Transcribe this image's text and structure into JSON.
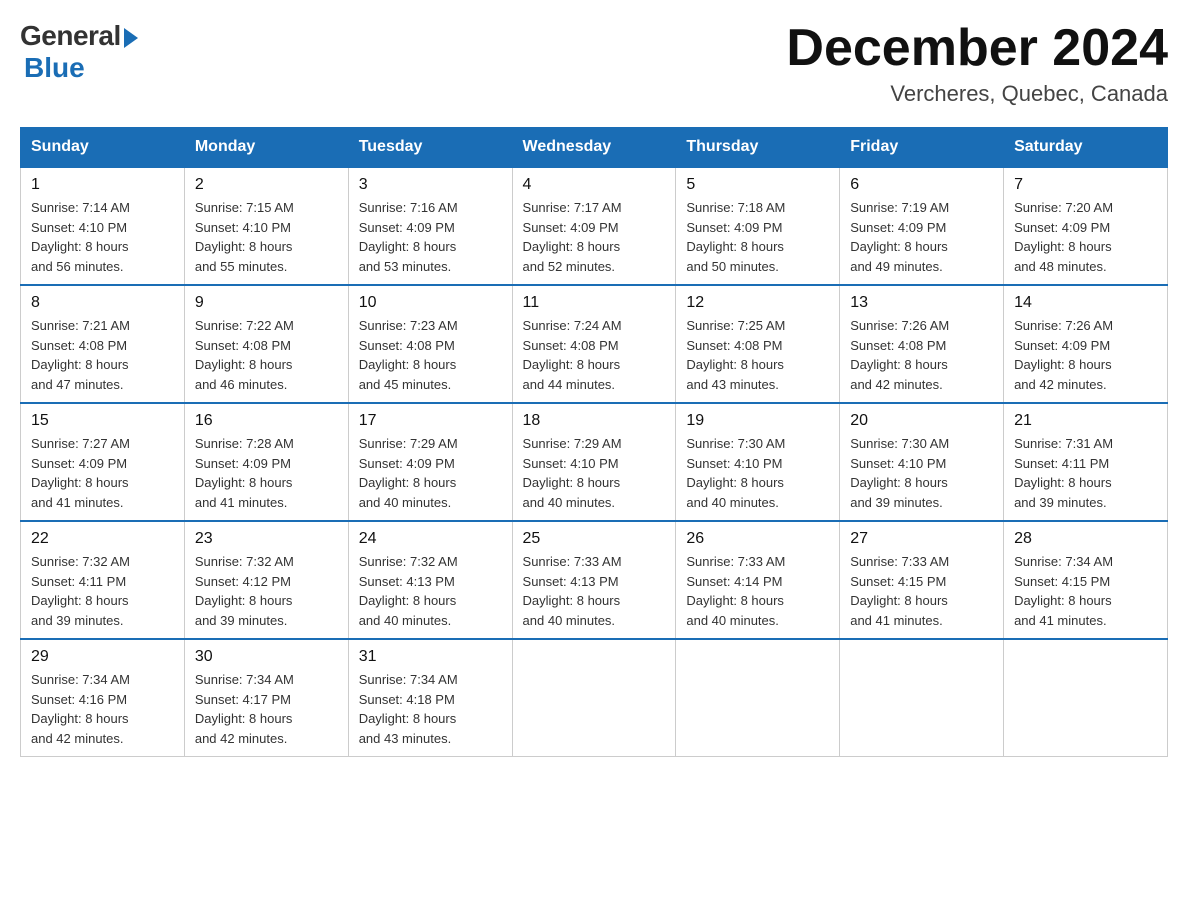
{
  "header": {
    "logo_general": "General",
    "logo_blue": "Blue",
    "month_title": "December 2024",
    "location": "Vercheres, Quebec, Canada"
  },
  "days_of_week": [
    "Sunday",
    "Monday",
    "Tuesday",
    "Wednesday",
    "Thursday",
    "Friday",
    "Saturday"
  ],
  "weeks": [
    [
      {
        "day": "1",
        "sunrise": "7:14 AM",
        "sunset": "4:10 PM",
        "daylight": "8 hours and 56 minutes."
      },
      {
        "day": "2",
        "sunrise": "7:15 AM",
        "sunset": "4:10 PM",
        "daylight": "8 hours and 55 minutes."
      },
      {
        "day": "3",
        "sunrise": "7:16 AM",
        "sunset": "4:09 PM",
        "daylight": "8 hours and 53 minutes."
      },
      {
        "day": "4",
        "sunrise": "7:17 AM",
        "sunset": "4:09 PM",
        "daylight": "8 hours and 52 minutes."
      },
      {
        "day": "5",
        "sunrise": "7:18 AM",
        "sunset": "4:09 PM",
        "daylight": "8 hours and 50 minutes."
      },
      {
        "day": "6",
        "sunrise": "7:19 AM",
        "sunset": "4:09 PM",
        "daylight": "8 hours and 49 minutes."
      },
      {
        "day": "7",
        "sunrise": "7:20 AM",
        "sunset": "4:09 PM",
        "daylight": "8 hours and 48 minutes."
      }
    ],
    [
      {
        "day": "8",
        "sunrise": "7:21 AM",
        "sunset": "4:08 PM",
        "daylight": "8 hours and 47 minutes."
      },
      {
        "day": "9",
        "sunrise": "7:22 AM",
        "sunset": "4:08 PM",
        "daylight": "8 hours and 46 minutes."
      },
      {
        "day": "10",
        "sunrise": "7:23 AM",
        "sunset": "4:08 PM",
        "daylight": "8 hours and 45 minutes."
      },
      {
        "day": "11",
        "sunrise": "7:24 AM",
        "sunset": "4:08 PM",
        "daylight": "8 hours and 44 minutes."
      },
      {
        "day": "12",
        "sunrise": "7:25 AM",
        "sunset": "4:08 PM",
        "daylight": "8 hours and 43 minutes."
      },
      {
        "day": "13",
        "sunrise": "7:26 AM",
        "sunset": "4:08 PM",
        "daylight": "8 hours and 42 minutes."
      },
      {
        "day": "14",
        "sunrise": "7:26 AM",
        "sunset": "4:09 PM",
        "daylight": "8 hours and 42 minutes."
      }
    ],
    [
      {
        "day": "15",
        "sunrise": "7:27 AM",
        "sunset": "4:09 PM",
        "daylight": "8 hours and 41 minutes."
      },
      {
        "day": "16",
        "sunrise": "7:28 AM",
        "sunset": "4:09 PM",
        "daylight": "8 hours and 41 minutes."
      },
      {
        "day": "17",
        "sunrise": "7:29 AM",
        "sunset": "4:09 PM",
        "daylight": "8 hours and 40 minutes."
      },
      {
        "day": "18",
        "sunrise": "7:29 AM",
        "sunset": "4:10 PM",
        "daylight": "8 hours and 40 minutes."
      },
      {
        "day": "19",
        "sunrise": "7:30 AM",
        "sunset": "4:10 PM",
        "daylight": "8 hours and 40 minutes."
      },
      {
        "day": "20",
        "sunrise": "7:30 AM",
        "sunset": "4:10 PM",
        "daylight": "8 hours and 39 minutes."
      },
      {
        "day": "21",
        "sunrise": "7:31 AM",
        "sunset": "4:11 PM",
        "daylight": "8 hours and 39 minutes."
      }
    ],
    [
      {
        "day": "22",
        "sunrise": "7:32 AM",
        "sunset": "4:11 PM",
        "daylight": "8 hours and 39 minutes."
      },
      {
        "day": "23",
        "sunrise": "7:32 AM",
        "sunset": "4:12 PM",
        "daylight": "8 hours and 39 minutes."
      },
      {
        "day": "24",
        "sunrise": "7:32 AM",
        "sunset": "4:13 PM",
        "daylight": "8 hours and 40 minutes."
      },
      {
        "day": "25",
        "sunrise": "7:33 AM",
        "sunset": "4:13 PM",
        "daylight": "8 hours and 40 minutes."
      },
      {
        "day": "26",
        "sunrise": "7:33 AM",
        "sunset": "4:14 PM",
        "daylight": "8 hours and 40 minutes."
      },
      {
        "day": "27",
        "sunrise": "7:33 AM",
        "sunset": "4:15 PM",
        "daylight": "8 hours and 41 minutes."
      },
      {
        "day": "28",
        "sunrise": "7:34 AM",
        "sunset": "4:15 PM",
        "daylight": "8 hours and 41 minutes."
      }
    ],
    [
      {
        "day": "29",
        "sunrise": "7:34 AM",
        "sunset": "4:16 PM",
        "daylight": "8 hours and 42 minutes."
      },
      {
        "day": "30",
        "sunrise": "7:34 AM",
        "sunset": "4:17 PM",
        "daylight": "8 hours and 42 minutes."
      },
      {
        "day": "31",
        "sunrise": "7:34 AM",
        "sunset": "4:18 PM",
        "daylight": "8 hours and 43 minutes."
      },
      null,
      null,
      null,
      null
    ]
  ],
  "labels": {
    "sunrise": "Sunrise:",
    "sunset": "Sunset:",
    "daylight": "Daylight:"
  }
}
